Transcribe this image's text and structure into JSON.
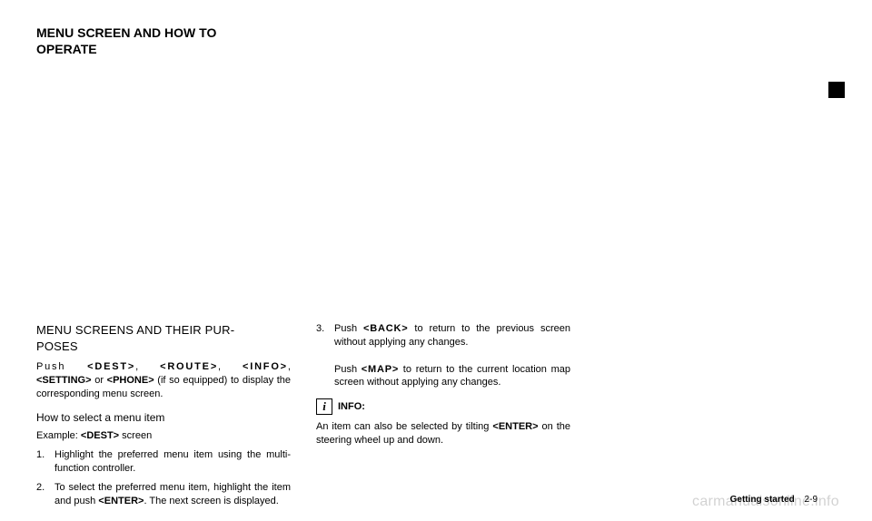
{
  "top_heading_line1": "MENU SCREEN AND HOW TO",
  "top_heading_line2": "OPERATE",
  "col1": {
    "subheading_line1": "MENU SCREENS AND THEIR PUR-",
    "subheading_line2": "POSES",
    "push_word": "Push",
    "btn_dest": "<DEST>",
    "btn_route": "<ROUTE>",
    "btn_info": "<INFO>",
    "btn_setting": "<SETTING>",
    "or_word": "or",
    "btn_phone": "<PHONE>",
    "if_equipped": "(if so equipped)",
    "para_display": "to display the corresponding menu screen.",
    "howto_heading": "How to select a menu item",
    "example_prefix": "Example:",
    "btn_dest2": "<DEST>",
    "example_suffix": "screen",
    "step1_num": "1.",
    "step1": "Highlight the preferred menu item using the multi-function controller.",
    "step2_num": "2.",
    "step2_a": "To select the preferred menu item, highlight the item and push ",
    "btn_enter": "<ENTER>",
    "step2_b": ". The next screen is displayed."
  },
  "col2": {
    "step3_num": "3.",
    "step3_a": "Push ",
    "btn_back": "<BACK>",
    "step3_b": " to return to the previous screen without applying any changes.",
    "step3_c": "Push ",
    "btn_map": "<MAP>",
    "step3_d": " to return to the current location map screen without applying any changes.",
    "info_label": "INFO:",
    "info_para_a": "An item can also be selected by tilting ",
    "btn_enter2": "<ENTER>",
    "info_para_b": " on the steering wheel up and down."
  },
  "footer_section": "Getting started",
  "footer_page": "2-9",
  "watermark": "carmanualsonline.info"
}
